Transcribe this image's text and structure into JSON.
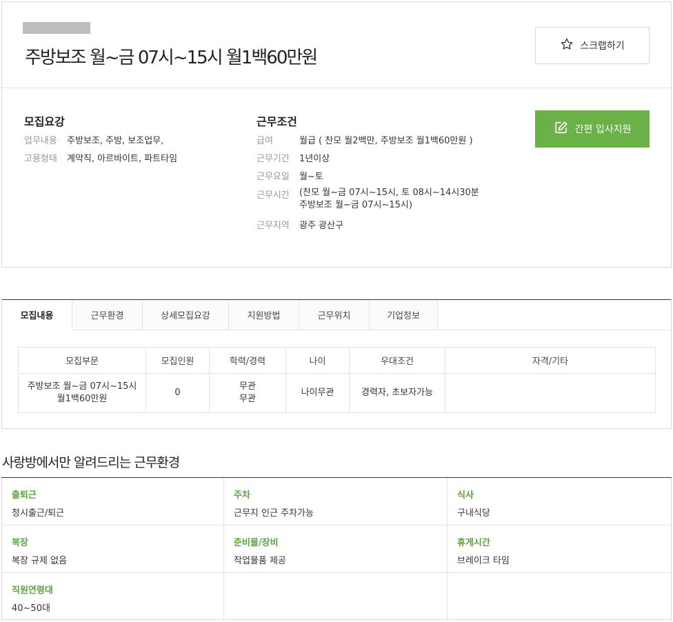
{
  "job": {
    "title": "주방보조 월~금 07시~15시 월1백60만원",
    "scrap_label": "스크랩하기",
    "apply_label": "간편 입사지원"
  },
  "recruit_summary": {
    "heading": "모집요강",
    "rows": [
      {
        "key": "업무내용",
        "value": "주방보조, 주방, 보조업무,"
      },
      {
        "key": "고용형태",
        "value": "계약직, 아르바이트, 파트타임"
      }
    ]
  },
  "work_conditions": {
    "heading": "근무조건",
    "rows": [
      {
        "key": "급여",
        "value": "월급 ( 찬모 월2백만, 주방보조 월1백60만원 )"
      },
      {
        "key": "근무기간",
        "value": "1년이상"
      },
      {
        "key": "근무요일",
        "value": "월~토"
      },
      {
        "key": "근무시간",
        "value": "(찬모 월~금 07시~15시, 토 08시~14시30분",
        "value2": "주방보조 월~금 07시~15시)"
      },
      {
        "key": "근무지역",
        "value": "광주 광산구"
      }
    ]
  },
  "tabs": [
    "모집내용",
    "근무환경",
    "상세모집요강",
    "지원방법",
    "근무위치",
    "기업정보"
  ],
  "recruit_table": {
    "headers": [
      "모집부문",
      "모집인원",
      "학력/경력",
      "나이",
      "우대조건",
      "자격/기타"
    ],
    "row": {
      "department_line1": "주방보조 월~금 07시~15시",
      "department_line2": "월1백60만원",
      "count": "0",
      "education": "무관",
      "career": "무관",
      "age": "나이무관",
      "preference": "경력자, 초보자가능",
      "etc": ""
    }
  },
  "environment": {
    "title": "사랑방에서만 알려드리는 근무환경",
    "items": [
      {
        "label": "출퇴근",
        "value": "정시출근/퇴근"
      },
      {
        "label": "주차",
        "value": "근무지 인근 주차가능"
      },
      {
        "label": "식사",
        "value": "구내식당"
      },
      {
        "label": "복장",
        "value": "복장 규제 없음"
      },
      {
        "label": "준비물/장비",
        "value": "작업물품 제공"
      },
      {
        "label": "휴게시간",
        "value": "브레이크 타임"
      },
      {
        "label": "직원연령대",
        "value": "40~50대"
      },
      {
        "label": "",
        "value": ""
      },
      {
        "label": "",
        "value": ""
      }
    ]
  },
  "colors": {
    "accent": "#6ab247",
    "env_label": "#5aa43a"
  },
  "icons": {
    "scrap": "star-outline-icon",
    "apply": "edit-icon"
  }
}
